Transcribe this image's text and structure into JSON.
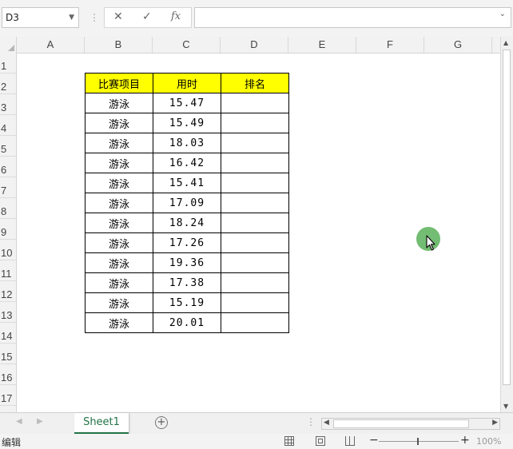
{
  "formula_bar": {
    "name_box": "D3",
    "cancel_icon": "✕",
    "enter_icon": "✓",
    "fx_label": "fx",
    "formula_value": ""
  },
  "columns": [
    "A",
    "B",
    "C",
    "D",
    "E",
    "F",
    "G"
  ],
  "rows": [
    "1",
    "2",
    "3",
    "4",
    "5",
    "6",
    "7",
    "8",
    "9",
    "10",
    "11",
    "12",
    "13",
    "14",
    "15",
    "16",
    "17"
  ],
  "table": {
    "headers": [
      "比赛项目",
      "用时",
      "排名"
    ],
    "header_color": "#ffff00",
    "rows": [
      [
        "游泳",
        "15.47",
        ""
      ],
      [
        "游泳",
        "15.49",
        ""
      ],
      [
        "游泳",
        "18.03",
        ""
      ],
      [
        "游泳",
        "16.42",
        ""
      ],
      [
        "游泳",
        "15.41",
        ""
      ],
      [
        "游泳",
        "17.09",
        ""
      ],
      [
        "游泳",
        "18.24",
        ""
      ],
      [
        "游泳",
        "17.26",
        ""
      ],
      [
        "游泳",
        "19.36",
        ""
      ],
      [
        "游泳",
        "17.38",
        ""
      ],
      [
        "游泳",
        "15.19",
        ""
      ],
      [
        "游泳",
        "20.01",
        ""
      ]
    ]
  },
  "sheet_tabs": {
    "active": "Sheet1",
    "add_icon": "plus-circle-icon"
  },
  "status_bar": {
    "mode": "编辑",
    "zoom": "100%"
  },
  "accent_color": "#217346",
  "cursor_highlight_color": "#6cb86b"
}
